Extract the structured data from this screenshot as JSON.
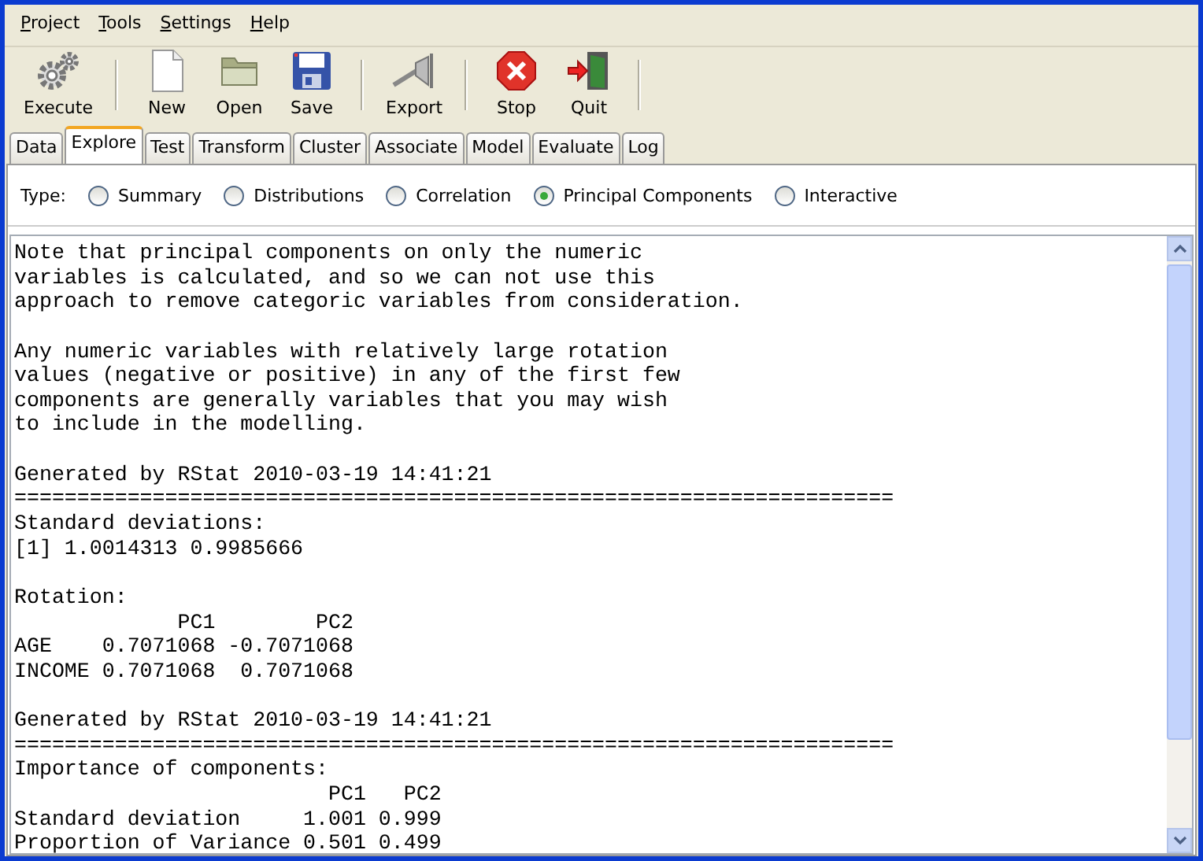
{
  "menu": [
    "Project",
    "Tools",
    "Settings",
    "Help"
  ],
  "toolbar": [
    [
      {
        "kind": "gear",
        "label": "Execute"
      }
    ],
    [
      {
        "kind": "page",
        "label": "New"
      },
      {
        "kind": "folder",
        "label": "Open"
      },
      {
        "kind": "disk",
        "label": "Save"
      }
    ],
    [
      {
        "kind": "export",
        "label": "Export"
      }
    ],
    [
      {
        "kind": "stop",
        "label": "Stop"
      },
      {
        "kind": "door",
        "label": "Quit"
      }
    ]
  ],
  "tabs": [
    {
      "label": "Data",
      "selected": false
    },
    {
      "label": "Explore",
      "selected": true
    },
    {
      "label": "Test",
      "selected": false
    },
    {
      "label": "Transform",
      "selected": false
    },
    {
      "label": "Cluster",
      "selected": false
    },
    {
      "label": "Associate",
      "selected": false
    },
    {
      "label": "Model",
      "selected": false
    },
    {
      "label": "Evaluate",
      "selected": false
    },
    {
      "label": "Log",
      "selected": false
    }
  ],
  "type_label": "Type:",
  "types": [
    {
      "label": "Summary",
      "selected": false
    },
    {
      "label": "Distributions",
      "selected": false
    },
    {
      "label": "Correlation",
      "selected": false
    },
    {
      "label": "Principal Components",
      "selected": true
    },
    {
      "label": "Interactive",
      "selected": false
    }
  ],
  "output": [
    [
      "Note that principal components on only the numeric",
      "variables is calculated, and so we can not use this",
      "approach to remove categoric variables from consideration."
    ],
    [
      "Any numeric variables with relatively large rotation",
      "values (negative or positive) in any of the first few",
      "components are generally variables that you may wish",
      "to include in the modelling."
    ],
    [
      "Generated by RStat 2010-03-19 14:41:21",
      "======================================================================",
      "Standard deviations:",
      "[1] 1.0014313 0.9985666"
    ],
    [
      "Rotation:",
      "             PC1        PC2",
      "AGE    0.7071068 -0.7071068",
      "INCOME 0.7071068  0.7071068"
    ],
    [
      "Generated by RStat 2010-03-19 14:41:21",
      "======================================================================",
      "Importance of components:",
      "                         PC1   PC2",
      "Standard deviation     1.001 0.999",
      "Proportion of Variance 0.501 0.499"
    ]
  ]
}
